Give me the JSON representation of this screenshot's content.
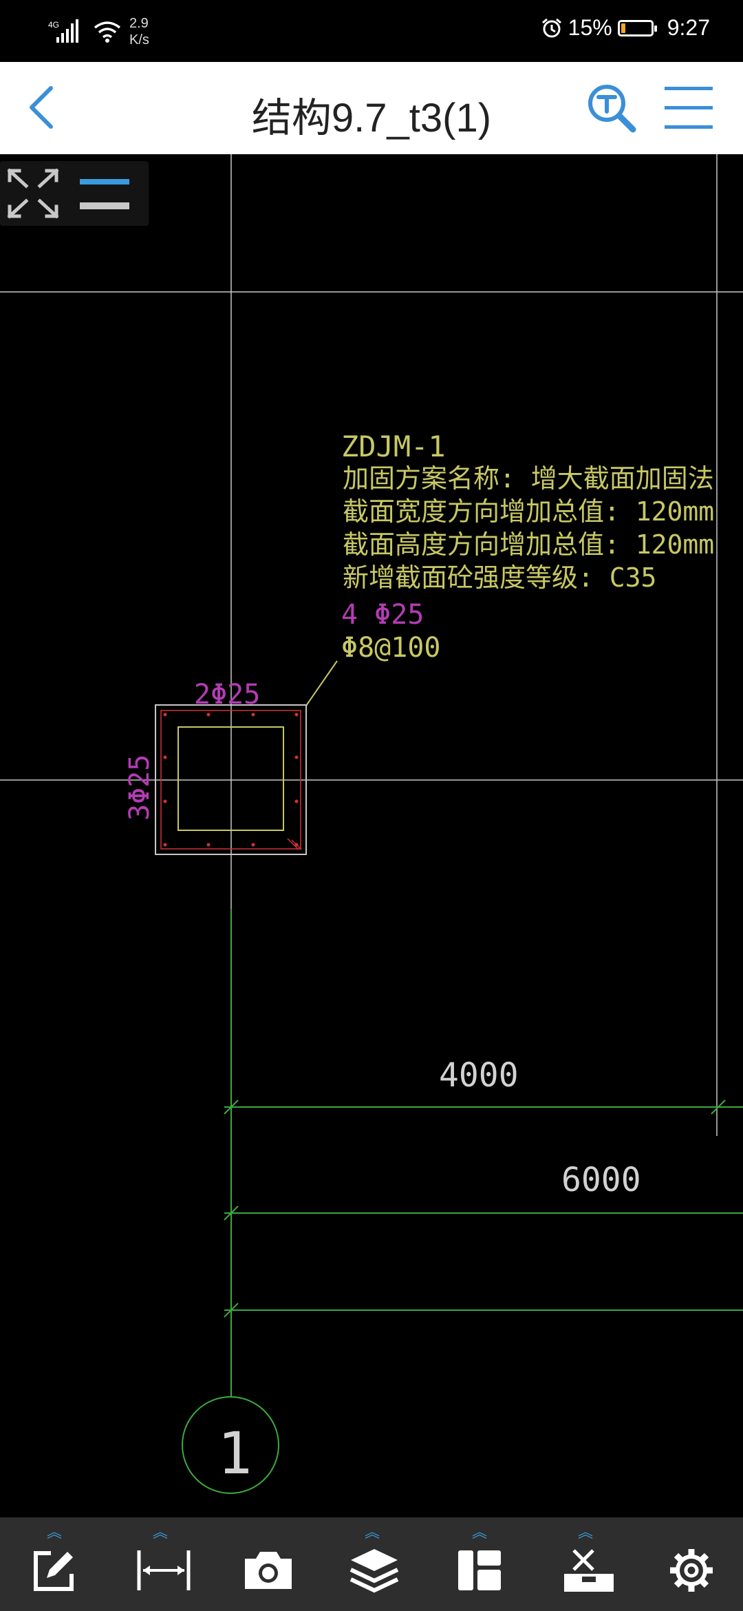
{
  "status_bar": {
    "network": "4G",
    "net_speed_value": "2.9",
    "net_speed_unit": "K/s",
    "battery_percent": "15%",
    "battery_level": 0.15,
    "time": "9:27",
    "icons": [
      "signal-icon",
      "wifi-icon",
      "alarm-icon",
      "battery-icon"
    ]
  },
  "header": {
    "title": "结构9.7_t3(1)",
    "back_icon": "chevron-left-icon",
    "search_icon": "text-search-icon",
    "menu_icon": "hamburger-menu-icon"
  },
  "floating_tools": {
    "fit_icon": "fit-screen-icon",
    "layer_icon": "layer-toggle-icon"
  },
  "drawing": {
    "annotation": {
      "id": "ZDJM-1",
      "lines": [
        "加固方案名称: 增大截面加固法",
        "截面宽度方向增加总值: 120mm",
        "截面高度方向增加总值: 120mm",
        "新增截面砼强度等级: C35"
      ],
      "main_rebar": "4 Φ25",
      "stirrup": "Φ8@100"
    },
    "column_top_rebar": "2Φ25",
    "column_side_rebar": "3Φ25",
    "dimension_1": "4000",
    "dimension_2": "6000",
    "axis_label": "1",
    "colors": {
      "background": "#000000",
      "grid_line": "#c8c8c8",
      "annotation_text": "#c8c864",
      "rebar_text": "#b43cb4",
      "dimension_line": "#3caa3c",
      "dimension_text": "#d2d2d2",
      "rebar_dots": "#d23232"
    }
  },
  "bottom_toolbar": {
    "tools": [
      {
        "name": "annotate-tool",
        "icon": "edit-icon",
        "has_menu": true
      },
      {
        "name": "measure-tool",
        "icon": "measure-icon",
        "has_menu": true
      },
      {
        "name": "camera-tool",
        "icon": "camera-icon",
        "has_menu": false
      },
      {
        "name": "layers-tool",
        "icon": "layers-icon",
        "has_menu": true
      },
      {
        "name": "layout-tool",
        "icon": "layout-icon",
        "has_menu": true
      },
      {
        "name": "toolbox-tool",
        "icon": "toolbox-icon",
        "has_menu": true
      },
      {
        "name": "settings-tool",
        "icon": "settings-icon",
        "has_menu": false
      }
    ],
    "accent_color": "#3a9bdc"
  }
}
